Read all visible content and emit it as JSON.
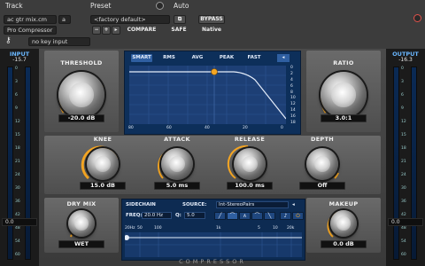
{
  "host": {
    "track_label": "Track",
    "preset_label": "Preset",
    "auto_label": "Auto",
    "track_name": "ac gtr mix.cm",
    "track_letter": "a",
    "plugin_name": "Pro Compressor",
    "preset_name": "<factory default>",
    "compare_label": "COMPARE",
    "safe_label": "SAFE",
    "bypass_label": "BYPASS",
    "native_label": "Native",
    "key_input": "no key input",
    "minus_label": "−",
    "plus_label": "+"
  },
  "input": {
    "label": "INPUT",
    "peak": "-15.7",
    "value": "0.0"
  },
  "output": {
    "label": "OUTPUT",
    "peak": "-16.3",
    "value": "0.0"
  },
  "meter_scale": [
    "0",
    "3",
    "6",
    "9",
    "12",
    "15",
    "18",
    "21",
    "24",
    "30",
    "36",
    "42",
    "48",
    "54",
    "60"
  ],
  "graph": {
    "tabs": [
      "SMART",
      "RMS",
      "AVG",
      "PEAK",
      "FAST"
    ],
    "active_tab": "SMART",
    "y_scale": [
      "0",
      "2",
      "4",
      "6",
      "8",
      "10",
      "12",
      "14",
      "16",
      "18"
    ],
    "x_scale": [
      "80",
      "60",
      "40",
      "20",
      "0"
    ]
  },
  "controls": {
    "threshold": {
      "label": "THRESHOLD",
      "value": "-20.0 dB"
    },
    "ratio": {
      "label": "RATIO",
      "value": "3.0:1"
    },
    "knee": {
      "label": "KNEE",
      "value": "15.0 dB"
    },
    "attack": {
      "label": "ATTACK",
      "value": "5.0 ms"
    },
    "release": {
      "label": "RELEASE",
      "value": "100.0 ms"
    },
    "depth": {
      "label": "DEPTH",
      "value": "Off"
    },
    "dry_mix": {
      "label": "DRY MIX",
      "value": "WET"
    },
    "makeup": {
      "label": "MAKEUP",
      "value": "0.0 dB"
    }
  },
  "sidechain": {
    "label": "SIDECHAIN",
    "source_label": "SOURCE:",
    "source_value": "Int-StereoPairs",
    "freq_label": "FREQ:",
    "freq_value": "20.0 Hz",
    "q_label": "Q:",
    "q_value": "5.0",
    "scale": [
      "20Hz",
      "50",
      "100",
      "1k",
      "5",
      "10",
      "20k"
    ]
  },
  "brand": "COMPRESSOR",
  "colors": {
    "accent_orange": "#f5a623",
    "graph_blue": "#1d3f75",
    "meter_label_blue": "#6ab7ff"
  }
}
